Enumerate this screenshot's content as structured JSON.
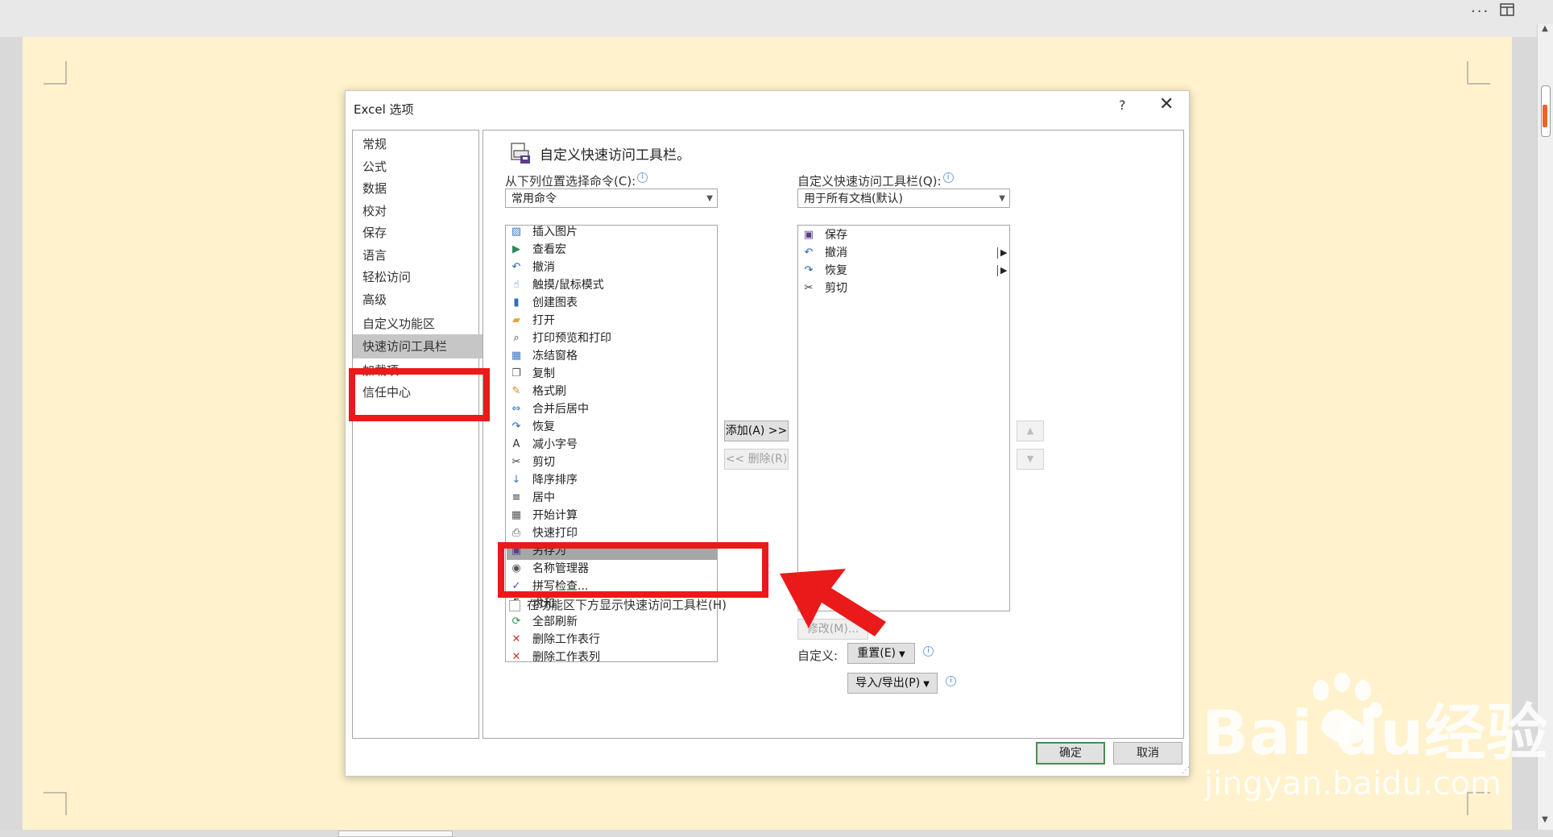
{
  "top_bar": {
    "more": "···",
    "layout_icon": "layout-icon"
  },
  "dialog": {
    "title": "Excel 选项",
    "help": "?",
    "close": "✕",
    "nav": {
      "items": [
        {
          "label": "常规"
        },
        {
          "label": "公式"
        },
        {
          "label": "数据"
        },
        {
          "label": "校对"
        },
        {
          "label": "保存"
        },
        {
          "label": "语言"
        },
        {
          "label": "轻松访问"
        },
        {
          "label": "高级"
        },
        {
          "label": "自定义功能区"
        },
        {
          "label": "快速访问工具栏"
        },
        {
          "label": "加载项"
        },
        {
          "label": "信任中心"
        }
      ],
      "selected": "快速访问工具栏"
    },
    "content": {
      "header": "自定义快速访问工具栏。",
      "choose_from_label": "从下列位置选择命令(C):",
      "choose_from_value": "常用命令",
      "customize_label": "自定义快速访问工具栏(Q):",
      "customize_value": "用于所有文档(默认)",
      "commands": [
        {
          "label": "插入图片",
          "icon": "insert-picture-icon",
          "glyph": "▨",
          "color": "#3b78c4"
        },
        {
          "label": "查看宏",
          "icon": "play-icon",
          "glyph": "▶",
          "color": "#2e8b57"
        },
        {
          "label": "撤消",
          "icon": "undo-icon",
          "glyph": "↶",
          "color": "#2060b0",
          "submenu": true
        },
        {
          "label": "触摸/鼠标模式",
          "icon": "touch-icon",
          "glyph": "☝",
          "color": "#3b78c4",
          "submenu": true
        },
        {
          "label": "创建图表",
          "icon": "chart-icon",
          "glyph": "▮",
          "color": "#2f6ec0"
        },
        {
          "label": "打开",
          "icon": "folder-icon",
          "glyph": "▰",
          "color": "#e0a73a"
        },
        {
          "label": "打印预览和打印",
          "icon": "print-preview-icon",
          "glyph": "⌕",
          "color": "#444444"
        },
        {
          "label": "冻结窗格",
          "icon": "freeze-panes-icon",
          "glyph": "▦",
          "color": "#3b78c4",
          "submenu": true
        },
        {
          "label": "复制",
          "icon": "copy-icon",
          "glyph": "❐",
          "color": "#555555"
        },
        {
          "label": "格式刷",
          "icon": "format-painter-icon",
          "glyph": "✎",
          "color": "#d08a2a"
        },
        {
          "label": "合并后居中",
          "icon": "merge-center-icon",
          "glyph": "⇔",
          "color": "#3b78c4"
        },
        {
          "label": "恢复",
          "icon": "redo-icon",
          "glyph": "↷",
          "color": "#2060b0",
          "submenu": true
        },
        {
          "label": "减小字号",
          "icon": "decrease-font-icon",
          "glyph": "A",
          "color": "#333333"
        },
        {
          "label": "剪切",
          "icon": "cut-icon",
          "glyph": "✂",
          "color": "#333333"
        },
        {
          "label": "降序排序",
          "icon": "sort-desc-icon",
          "glyph": "↓",
          "color": "#3b78c4"
        },
        {
          "label": "居中",
          "icon": "align-center-icon",
          "glyph": "≡",
          "color": "#333333"
        },
        {
          "label": "开始计算",
          "icon": "calculator-icon",
          "glyph": "▦",
          "color": "#555555"
        },
        {
          "label": "快速打印",
          "icon": "quick-print-icon",
          "glyph": "⎙",
          "color": "#555555"
        },
        {
          "label": "另存为",
          "icon": "save-as-icon",
          "glyph": "▣",
          "color": "#5b3d8c"
        },
        {
          "label": "名称管理器",
          "icon": "name-manager-icon",
          "glyph": "◉",
          "color": "#555555"
        },
        {
          "label": "拼写检查...",
          "icon": "spell-check-icon",
          "glyph": "✓",
          "color": "#2060b0"
        },
        {
          "label": "求和",
          "icon": "sum-icon",
          "glyph": "Σ",
          "color": "#222222"
        },
        {
          "label": "全部刷新",
          "icon": "refresh-all-icon",
          "glyph": "⟳",
          "color": "#2e8b57"
        },
        {
          "label": "删除工作表行",
          "icon": "delete-row-icon",
          "glyph": "✕",
          "color": "#d03030"
        },
        {
          "label": "删除工作表列",
          "icon": "delete-column-icon",
          "glyph": "✕",
          "color": "#d03030"
        }
      ],
      "selected_command": "另存为",
      "toolbar_items": [
        {
          "label": "保存",
          "icon": "save-icon",
          "glyph": "▣",
          "color": "#5b3d8c"
        },
        {
          "label": "撤消",
          "icon": "undo-icon",
          "glyph": "↶",
          "color": "#2060b0",
          "submenu": true
        },
        {
          "label": "恢复",
          "icon": "redo-icon",
          "glyph": "↷",
          "color": "#2060b0",
          "submenu": true
        },
        {
          "label": "剪切",
          "icon": "cut-icon",
          "glyph": "✂",
          "color": "#333333"
        }
      ],
      "add_button": "添加(A) >>",
      "remove_button": "<< 删除(R)",
      "modify_button": "修改(M)...",
      "customize_label_bottom": "自定义:",
      "reset_button": "重置(E)",
      "import_export_button": "导入/导出(P)",
      "show_below_ribbon": "在功能区下方显示快速访问工具栏(H)"
    },
    "ok_button": "确定",
    "cancel_button": "取消"
  },
  "watermark": {
    "brand": "Bai  du经验",
    "url": "jingyan.baidu.com"
  },
  "colors": {
    "highlight": "#ea1a1a",
    "page_bg": "#fff2cc",
    "selection": "#a6a6a6"
  }
}
